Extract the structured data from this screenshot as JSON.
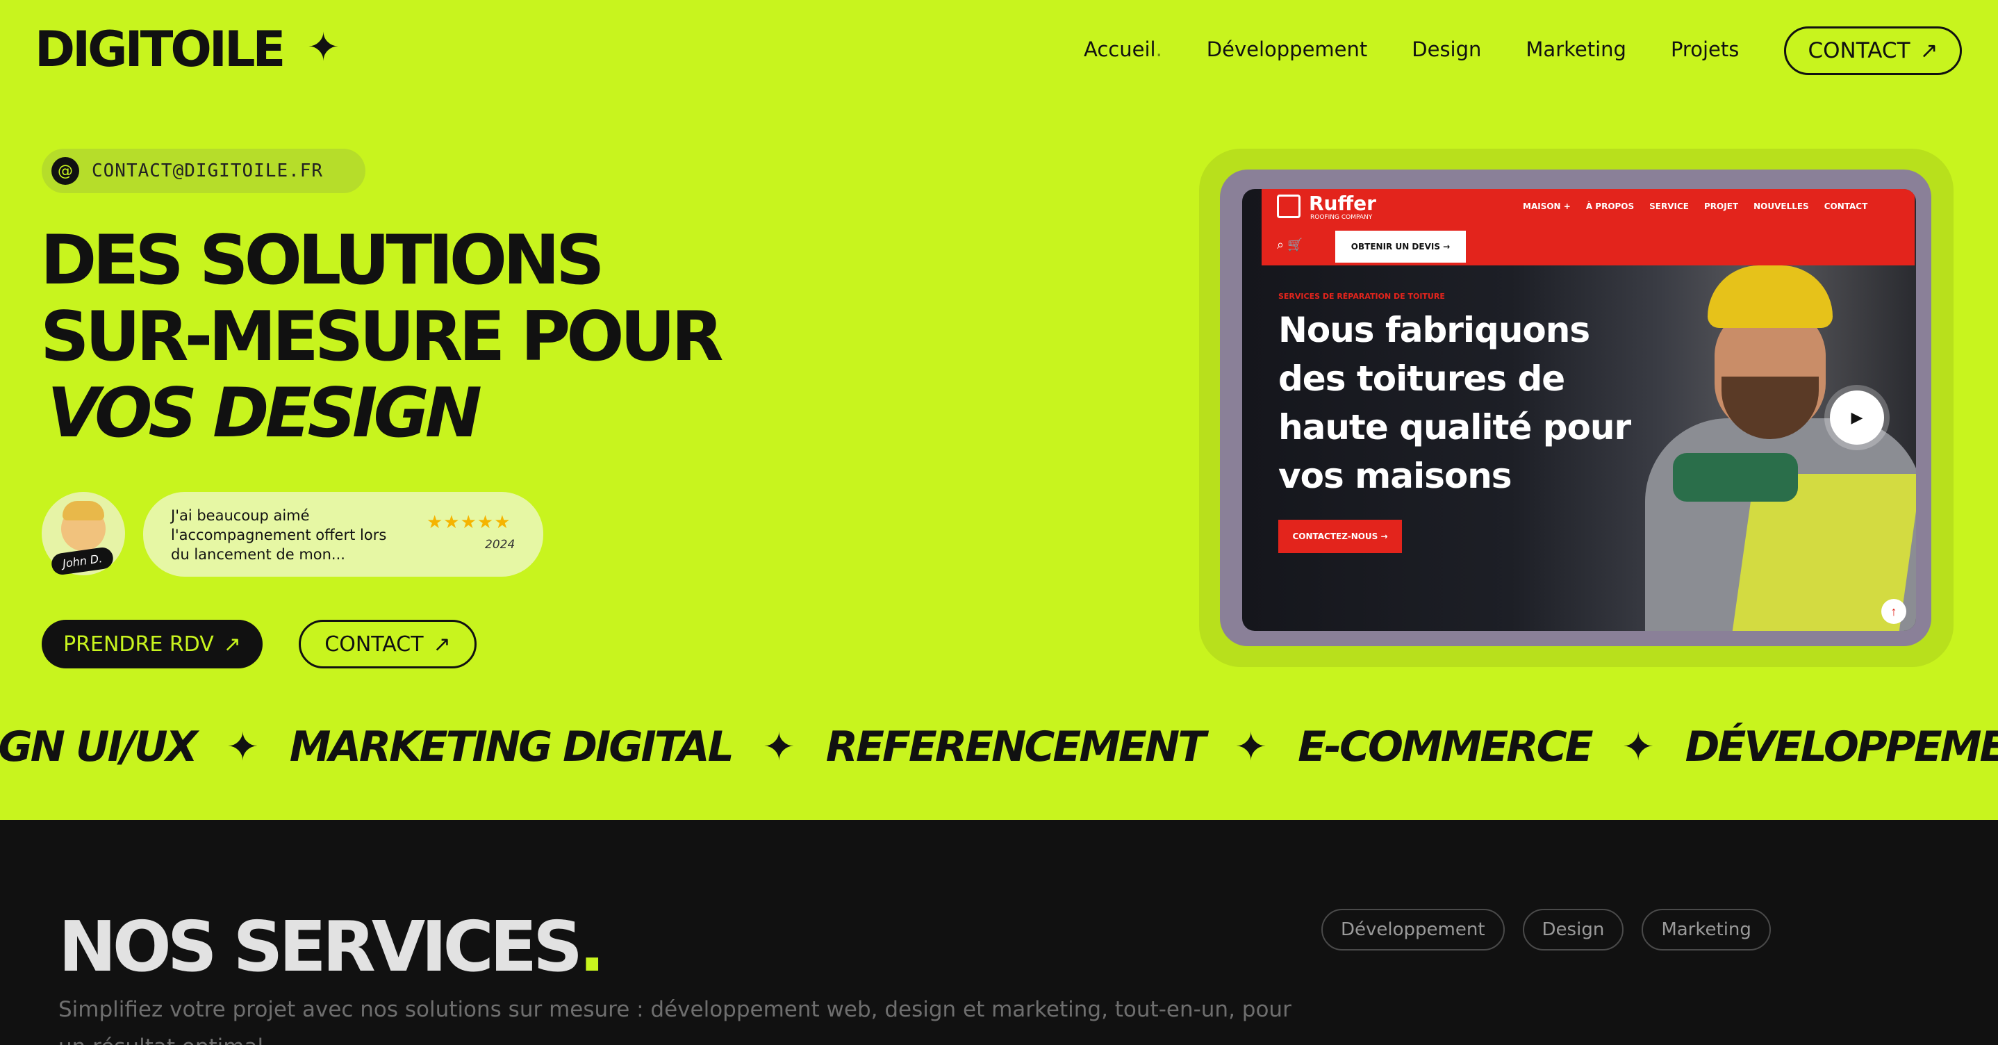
{
  "header": {
    "logo": "DIGITOILE",
    "logo_star": "✦",
    "nav": [
      {
        "label": "Accueil",
        "suffix": "."
      },
      {
        "label": "Développement",
        "suffix": ""
      },
      {
        "label": "Design",
        "suffix": ""
      },
      {
        "label": "Marketing",
        "suffix": ""
      },
      {
        "label": "Projets",
        "suffix": ""
      }
    ],
    "contact_label": "CONTACT",
    "arrow": "↗"
  },
  "hero": {
    "email_icon": "@",
    "email": "CONTACT@DIGITOILE.FR",
    "title_line1": "DES SOLUTIONS",
    "title_line2": "SUR-MESURE POUR",
    "title_line3": "VOS DESIGN",
    "avatar_name": "John D.",
    "review_text": "J'ai beaucoup aimé l'accompagnement offert lors du lancement de mon...",
    "review_stars": "★★★★★",
    "review_year": "2024",
    "btn_rdv": "PRENDRE RDV",
    "btn_contact": "CONTACT",
    "arrow": "↗"
  },
  "showcase": {
    "logo": "Ruffer",
    "logo_sub": "ROOFING COMPANY",
    "menu": [
      "MAISON +",
      "À PROPOS",
      "SERVICE",
      "PROJET",
      "NOUVELLES",
      "CONTACT"
    ],
    "icons": "⌕ 🛒",
    "quote_btn": "OBTENIR UN DEVIS →",
    "kicker": "SERVICES DE RÉPARATION DE TOITURE",
    "heading": "Nous fabriquons des toitures de haute qualité pour vos maisons",
    "cta": "CONTACTEZ-NOUS →",
    "play": "▶",
    "up": "↑"
  },
  "marquee": {
    "items": [
      "ESIGN UI/UX",
      "MARKETING DIGITAL",
      "REFERENCEMENT",
      "E-COMMERCE",
      "DÉVELOPPEMEN"
    ],
    "star": "✦"
  },
  "services": {
    "title": "NOS SERVICES",
    "title_dot": ".",
    "description": "Simplifiez votre projet avec nos solutions sur mesure : développement web, design et marketing, tout-en-un, pour un résultat optimal.",
    "tags": [
      "Développement",
      "Design",
      "Marketing"
    ]
  },
  "colors": {
    "accent": "#c8f41e",
    "dark": "#111111",
    "red": "#e3241c"
  }
}
